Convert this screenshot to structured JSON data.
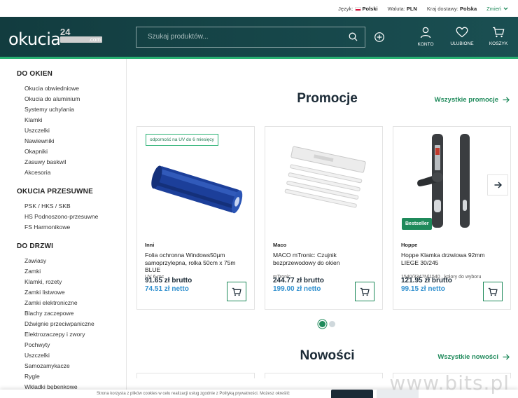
{
  "topbar": {
    "language_label": "Język:",
    "language_value": "Polski",
    "currency_label": "Waluta:",
    "currency_value": "PLN",
    "country_label": "Kraj dostawy:",
    "country_value": "Polska",
    "change_label": "Zmień"
  },
  "header": {
    "logo_text": "okucia",
    "logo_number": "24",
    "logo_domain": ".com",
    "search_placeholder": "Szukaj produktów...",
    "account_label": "KONTO",
    "favorites_label": "ULUBIONE",
    "cart_label": "KOSZYK"
  },
  "sidebar": {
    "groups": [
      {
        "title": "DO OKIEN",
        "items": [
          "Okucia obwiedniowe",
          "Okucia do aluminium",
          "Systemy uchylania",
          "Klamki",
          "Uszczelki",
          "Nawiewniki",
          "Okapniki",
          "Zasuwy baskwil",
          "Akcesoria"
        ]
      },
      {
        "title": "OKUCIA PRZESUWNE",
        "items": [
          "PSK / HKS / SKB",
          "HS Podnoszono-przesuwne",
          "FS Harmonikowe"
        ]
      },
      {
        "title": "DO DRZWI",
        "items": [
          "Zawiasy",
          "Zamki",
          "Klamki, rozety",
          "Zamki listwowe",
          "Zamki elektroniczne",
          "Blachy zaczepowe",
          "Dźwignie przeciwpaniczne",
          "Elektrozaczepy i zwory",
          "Pochwyty",
          "Uszczelki",
          "Samozamykacze",
          "Rygle",
          "Wkładki bębenkowe"
        ]
      }
    ]
  },
  "promotions": {
    "title": "Promocje",
    "link": "Wszystkie promocje",
    "products": [
      {
        "badge": "odporność na UV do 6 miesięcy",
        "brand": "Inni",
        "name": "Folia ochronna Windows50µm samoprzylepna, rolka 50cm x 75m BLUE",
        "sub": "UV 6-mc",
        "brutto": "91.65 zł brutto",
        "netto": "74.51 zł netto"
      },
      {
        "badge": "",
        "brand": "Maco",
        "name": "MACO mTronic: Czujnik bezprzewodowy do okien",
        "sub": "mTronic",
        "brutto": "244.77 zł brutto",
        "netto": "199.00 zł netto"
      },
      {
        "badge": "Bestseller",
        "brand": "Hoppe",
        "name": "Hoppe Klamka drzwiowa 92mm LIEGE 30/245",
        "sub": "1540/3347N/1540 , kolory do wyboru",
        "brutto": "121.95 zł brutto",
        "netto": "99.15 zł netto"
      }
    ]
  },
  "novelties": {
    "title": "Nowości",
    "link": "Wszystkie nowości"
  },
  "cookie": {
    "text": "Strona korzysta z plików cookies w celu realizacji usług zgodnie z Polityką prywatności. Możesz określić"
  },
  "watermark": "www.bits.pl",
  "colors": {
    "accent": "#1f8a5b",
    "header": "#123c3f",
    "netto": "#2f8fce"
  }
}
